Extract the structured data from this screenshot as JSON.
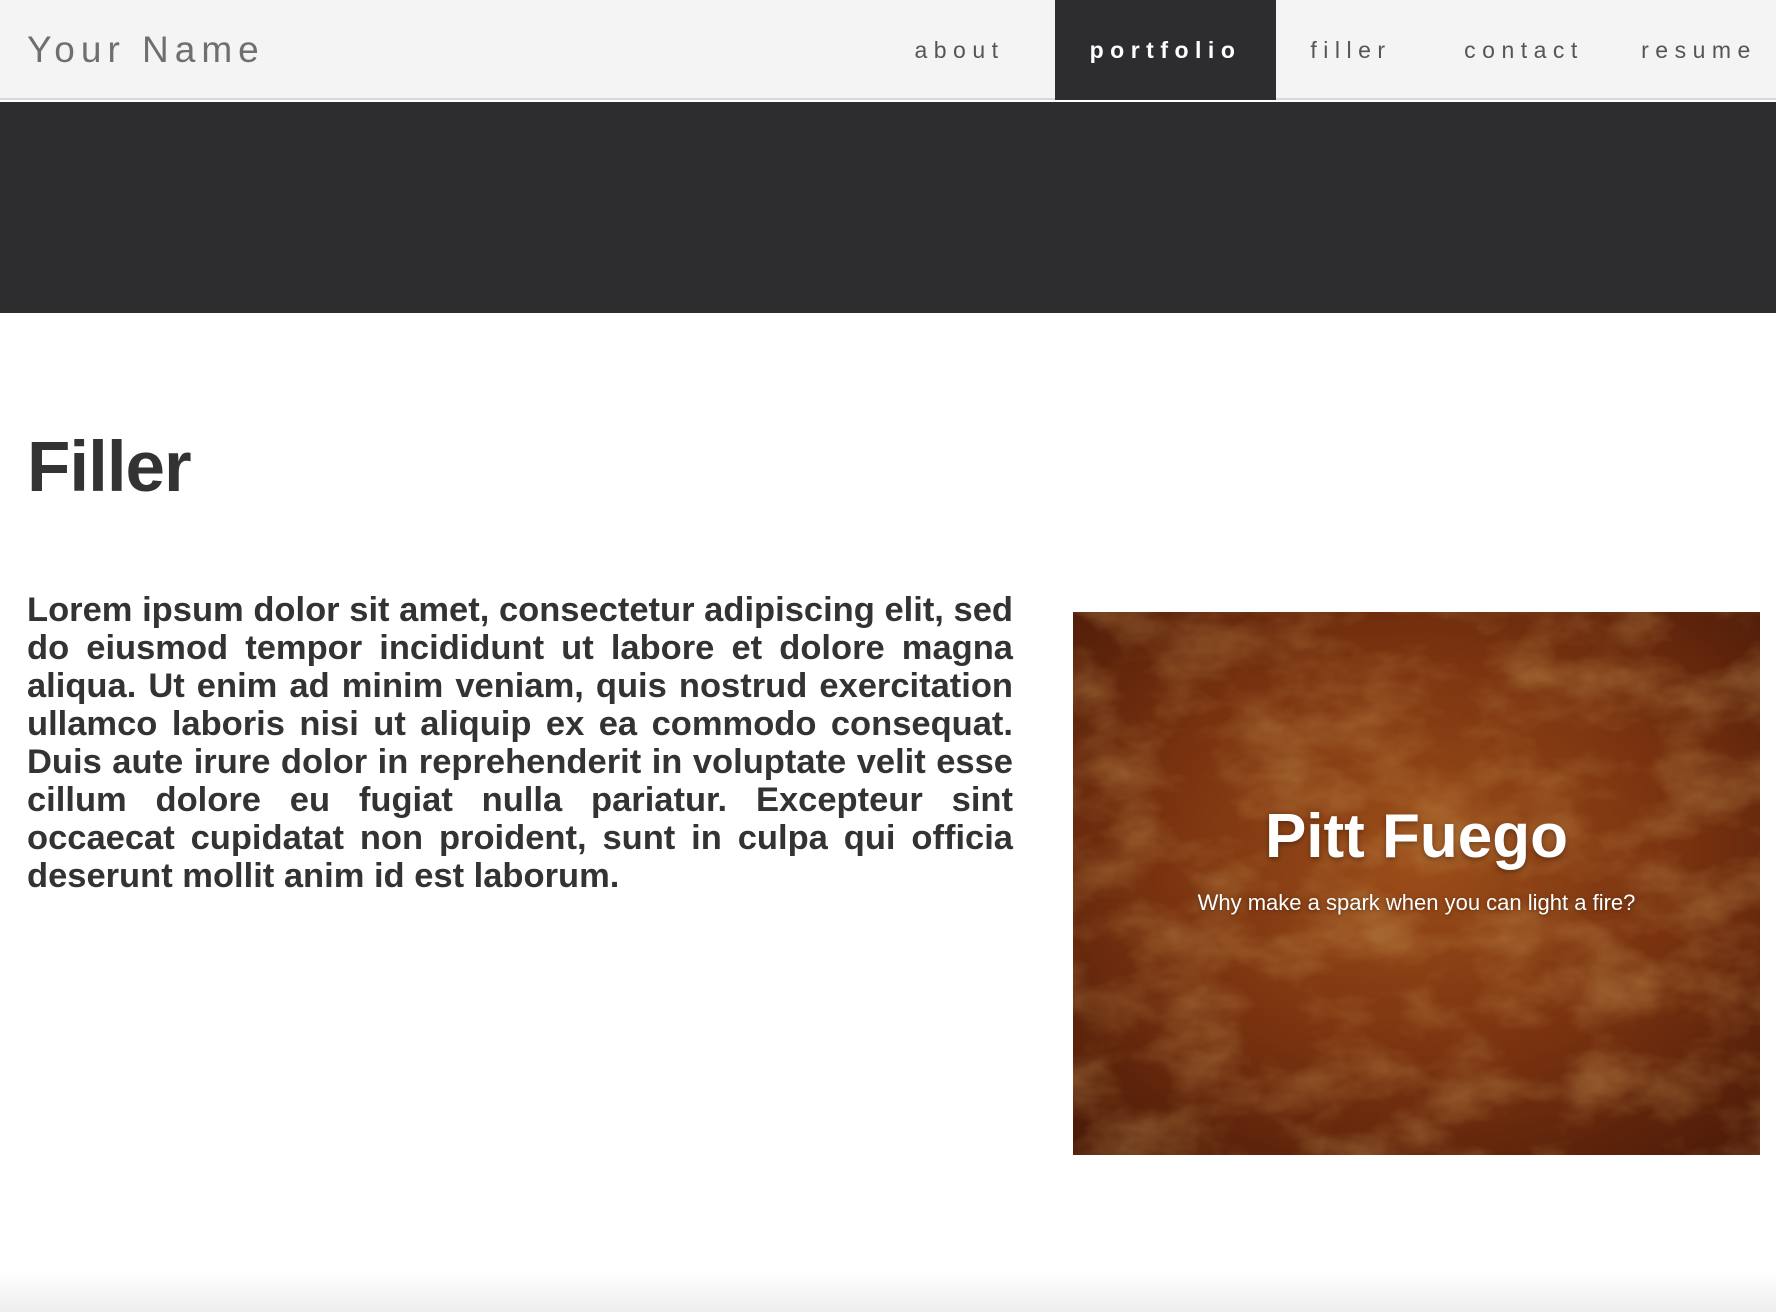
{
  "header": {
    "brand": "Your Name",
    "nav": [
      {
        "label": "about",
        "active": false
      },
      {
        "label": "portfolio",
        "active": true
      },
      {
        "label": "filler",
        "active": false
      },
      {
        "label": "contact",
        "active": false
      },
      {
        "label": "resume",
        "active": false
      }
    ]
  },
  "section": {
    "title": "Filler",
    "body": "Lorem ipsum dolor sit amet, consectetur adipiscing elit, sed do eiusmod tempor incididunt ut labore et dolore magna aliqua. Ut enim ad minim veniam, quis nostrud exercitation ullamco laboris nisi ut aliquip ex ea commodo consequat. Duis aute irure dolor in reprehenderit in voluptate velit esse cillum dolore eu fugiat nulla pariatur. Excepteur sint occaecat cupidatat non proident, sunt in culpa qui officia deserunt mollit anim id est laborum."
  },
  "project_card": {
    "title": "Pitt Fuego",
    "subtitle": "Why make a spark when you can light a fire?"
  },
  "colors": {
    "navbar_bg": "#f4f4f4",
    "active_nav_bg": "#2d2d2f",
    "hero_band": "#2d2d2f",
    "text_dark": "#333333",
    "fire_dark": "#6b2a0c",
    "fire_mid": "#a04a16",
    "fire_light": "#d27a2a"
  }
}
